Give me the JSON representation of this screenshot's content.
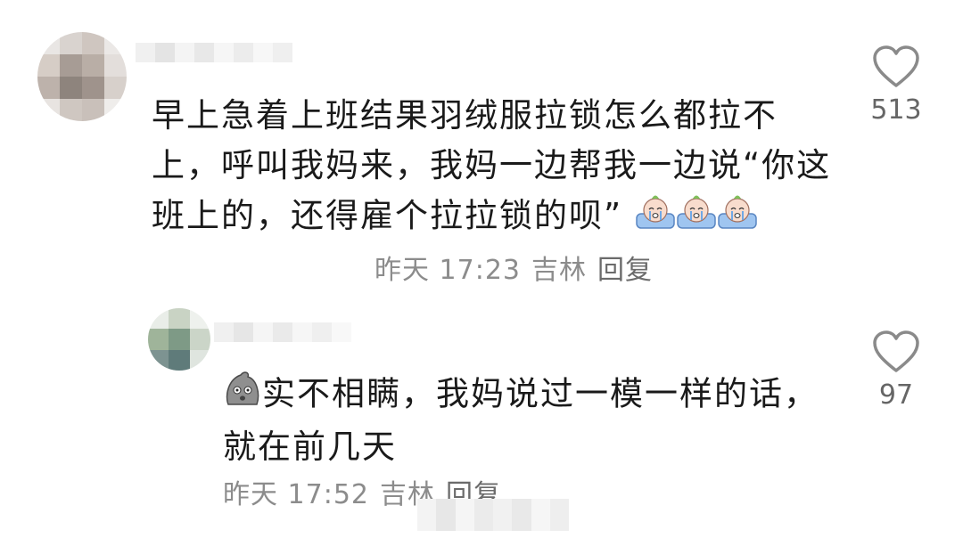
{
  "comments": [
    {
      "text": "早上急着上班结果羽绒服拉锁怎么都拉不上，呼叫我妈来，我妈一边帮我一边说“你这班上的，还得雇个拉拉锁的呗”",
      "time": "昨天 17:23",
      "location": "吉林",
      "reply_label": "回复",
      "likes": "513",
      "emojis": [
        "crying-baby-emoji",
        "crying-baby-emoji",
        "crying-baby-emoji"
      ]
    },
    {
      "text": "实不相瞒，我妈说过一模一样的话，就在前几天",
      "time": "昨天 17:52",
      "location": "吉林",
      "reply_label": "回复",
      "likes": "97",
      "leading_emoji": "gray-shocked-blob-emoji"
    }
  ],
  "icons": {
    "like": "heart-outline-icon"
  },
  "colors": {
    "text": "#1a1a1a",
    "meta": "#8c8c8c",
    "icon": "#8a8a8a"
  }
}
